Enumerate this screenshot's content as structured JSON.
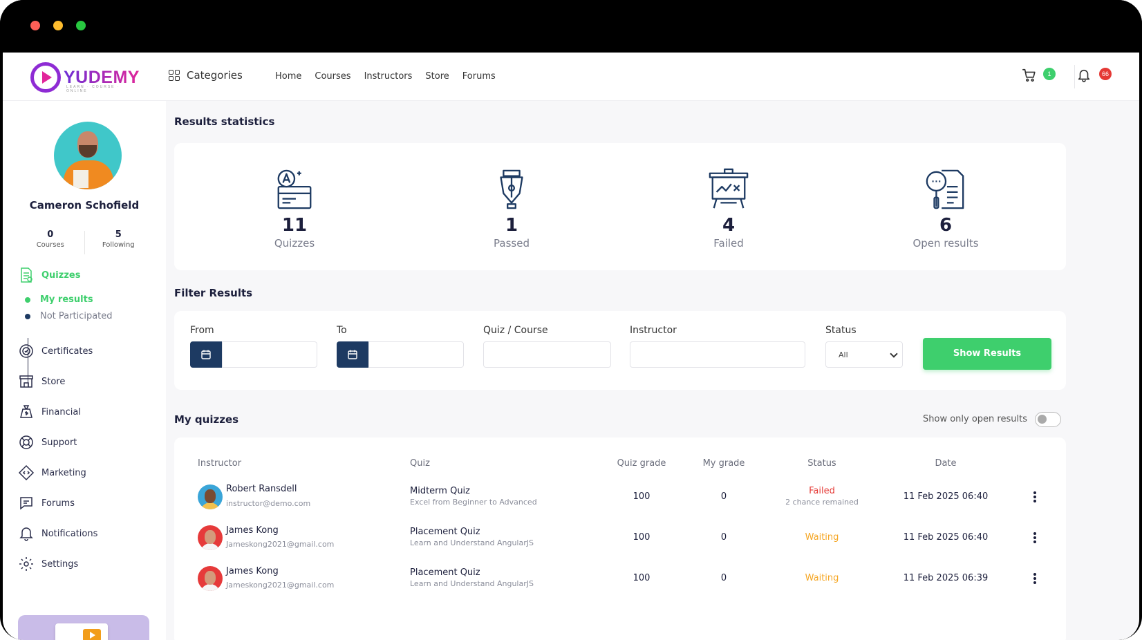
{
  "header": {
    "logo_text": "YUDEMY",
    "logo_tagline": "LEARN · COURSE · ONLINE",
    "categories_label": "Categories",
    "nav": [
      "Home",
      "Courses",
      "Instructors",
      "Store",
      "Forums"
    ],
    "cart_count": "1",
    "notification_count": "66"
  },
  "profile": {
    "name": "Cameron Schofield",
    "courses_count": "0",
    "courses_label": "Courses",
    "following_count": "5",
    "following_label": "Following"
  },
  "sidebar": {
    "quizzes_label": "Quizzes",
    "my_results_label": "My results",
    "not_participated_label": "Not Participated",
    "items": [
      "Certificates",
      "Store",
      "Financial",
      "Support",
      "Marketing",
      "Forums",
      "Notifications",
      "Settings"
    ]
  },
  "results_statistics": {
    "title": "Results statistics",
    "stats": [
      {
        "value": "11",
        "label": "Quizzes",
        "icon": "quiz-icon"
      },
      {
        "value": "1",
        "label": "Passed",
        "icon": "pen-nib-icon"
      },
      {
        "value": "4",
        "label": "Failed",
        "icon": "failed-board-icon"
      },
      {
        "value": "6",
        "label": "Open results",
        "icon": "search-document-icon"
      }
    ]
  },
  "filter": {
    "title": "Filter Results",
    "from_label": "From",
    "to_label": "To",
    "quiz_course_label": "Quiz / Course",
    "instructor_label": "Instructor",
    "status_label": "Status",
    "status_value": "All",
    "show_button": "Show Results"
  },
  "my_quizzes": {
    "title": "My quizzes",
    "toggle_label": "Show only open results",
    "columns": [
      "Instructor",
      "Quiz",
      "Quiz grade",
      "My grade",
      "Status",
      "Date"
    ],
    "rows": [
      {
        "instructor": "Robert Ransdell",
        "email": "instructor@demo.com",
        "quiz": "Midterm Quiz",
        "course": "Excel from Beginner to Advanced",
        "quiz_grade": "100",
        "my_grade": "0",
        "status": "Failed",
        "status_note": "2 chance remained",
        "date": "11 Feb 2025 06:40"
      },
      {
        "instructor": "James Kong",
        "email": "Jameskong2021@gmail.com",
        "quiz": "Placement Quiz",
        "course": "Learn and Understand AngularJS",
        "quiz_grade": "100",
        "my_grade": "0",
        "status": "Waiting",
        "status_note": "",
        "date": "11 Feb 2025 06:40"
      },
      {
        "instructor": "James Kong",
        "email": "Jameskong2021@gmail.com",
        "quiz": "Placement Quiz",
        "course": "Learn and Understand AngularJS",
        "quiz_grade": "100",
        "my_grade": "0",
        "status": "Waiting",
        "status_note": "",
        "date": "11 Feb 2025 06:39"
      }
    ]
  },
  "colors": {
    "accent_green": "#3ecf6d",
    "navy": "#1c1f3c",
    "failed_red": "#e53935",
    "waiting_orange": "#f5a623"
  }
}
